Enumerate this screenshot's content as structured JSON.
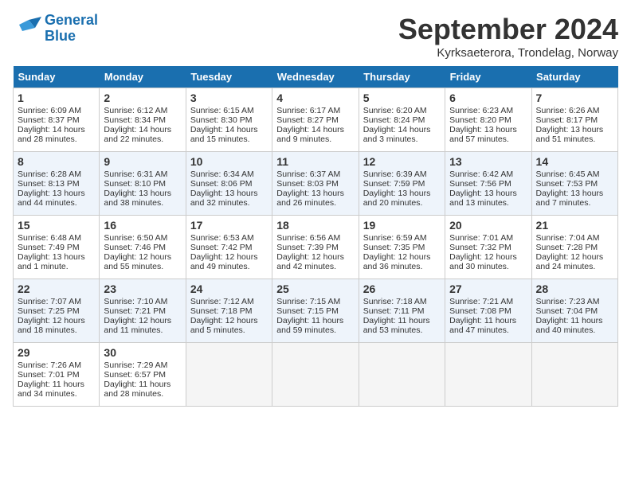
{
  "logo": {
    "line1": "General",
    "line2": "Blue"
  },
  "title": "September 2024",
  "subtitle": "Kyrksaeterora, Trondelag, Norway",
  "days_of_week": [
    "Sunday",
    "Monday",
    "Tuesday",
    "Wednesday",
    "Thursday",
    "Friday",
    "Saturday"
  ],
  "weeks": [
    [
      {
        "day": 1,
        "lines": [
          "Sunrise: 6:09 AM",
          "Sunset: 8:37 PM",
          "Daylight: 14 hours",
          "and 28 minutes."
        ]
      },
      {
        "day": 2,
        "lines": [
          "Sunrise: 6:12 AM",
          "Sunset: 8:34 PM",
          "Daylight: 14 hours",
          "and 22 minutes."
        ]
      },
      {
        "day": 3,
        "lines": [
          "Sunrise: 6:15 AM",
          "Sunset: 8:30 PM",
          "Daylight: 14 hours",
          "and 15 minutes."
        ]
      },
      {
        "day": 4,
        "lines": [
          "Sunrise: 6:17 AM",
          "Sunset: 8:27 PM",
          "Daylight: 14 hours",
          "and 9 minutes."
        ]
      },
      {
        "day": 5,
        "lines": [
          "Sunrise: 6:20 AM",
          "Sunset: 8:24 PM",
          "Daylight: 14 hours",
          "and 3 minutes."
        ]
      },
      {
        "day": 6,
        "lines": [
          "Sunrise: 6:23 AM",
          "Sunset: 8:20 PM",
          "Daylight: 13 hours",
          "and 57 minutes."
        ]
      },
      {
        "day": 7,
        "lines": [
          "Sunrise: 6:26 AM",
          "Sunset: 8:17 PM",
          "Daylight: 13 hours",
          "and 51 minutes."
        ]
      }
    ],
    [
      {
        "day": 8,
        "lines": [
          "Sunrise: 6:28 AM",
          "Sunset: 8:13 PM",
          "Daylight: 13 hours",
          "and 44 minutes."
        ]
      },
      {
        "day": 9,
        "lines": [
          "Sunrise: 6:31 AM",
          "Sunset: 8:10 PM",
          "Daylight: 13 hours",
          "and 38 minutes."
        ]
      },
      {
        "day": 10,
        "lines": [
          "Sunrise: 6:34 AM",
          "Sunset: 8:06 PM",
          "Daylight: 13 hours",
          "and 32 minutes."
        ]
      },
      {
        "day": 11,
        "lines": [
          "Sunrise: 6:37 AM",
          "Sunset: 8:03 PM",
          "Daylight: 13 hours",
          "and 26 minutes."
        ]
      },
      {
        "day": 12,
        "lines": [
          "Sunrise: 6:39 AM",
          "Sunset: 7:59 PM",
          "Daylight: 13 hours",
          "and 20 minutes."
        ]
      },
      {
        "day": 13,
        "lines": [
          "Sunrise: 6:42 AM",
          "Sunset: 7:56 PM",
          "Daylight: 13 hours",
          "and 13 minutes."
        ]
      },
      {
        "day": 14,
        "lines": [
          "Sunrise: 6:45 AM",
          "Sunset: 7:53 PM",
          "Daylight: 13 hours",
          "and 7 minutes."
        ]
      }
    ],
    [
      {
        "day": 15,
        "lines": [
          "Sunrise: 6:48 AM",
          "Sunset: 7:49 PM",
          "Daylight: 13 hours",
          "and 1 minute."
        ]
      },
      {
        "day": 16,
        "lines": [
          "Sunrise: 6:50 AM",
          "Sunset: 7:46 PM",
          "Daylight: 12 hours",
          "and 55 minutes."
        ]
      },
      {
        "day": 17,
        "lines": [
          "Sunrise: 6:53 AM",
          "Sunset: 7:42 PM",
          "Daylight: 12 hours",
          "and 49 minutes."
        ]
      },
      {
        "day": 18,
        "lines": [
          "Sunrise: 6:56 AM",
          "Sunset: 7:39 PM",
          "Daylight: 12 hours",
          "and 42 minutes."
        ]
      },
      {
        "day": 19,
        "lines": [
          "Sunrise: 6:59 AM",
          "Sunset: 7:35 PM",
          "Daylight: 12 hours",
          "and 36 minutes."
        ]
      },
      {
        "day": 20,
        "lines": [
          "Sunrise: 7:01 AM",
          "Sunset: 7:32 PM",
          "Daylight: 12 hours",
          "and 30 minutes."
        ]
      },
      {
        "day": 21,
        "lines": [
          "Sunrise: 7:04 AM",
          "Sunset: 7:28 PM",
          "Daylight: 12 hours",
          "and 24 minutes."
        ]
      }
    ],
    [
      {
        "day": 22,
        "lines": [
          "Sunrise: 7:07 AM",
          "Sunset: 7:25 PM",
          "Daylight: 12 hours",
          "and 18 minutes."
        ]
      },
      {
        "day": 23,
        "lines": [
          "Sunrise: 7:10 AM",
          "Sunset: 7:21 PM",
          "Daylight: 12 hours",
          "and 11 minutes."
        ]
      },
      {
        "day": 24,
        "lines": [
          "Sunrise: 7:12 AM",
          "Sunset: 7:18 PM",
          "Daylight: 12 hours",
          "and 5 minutes."
        ]
      },
      {
        "day": 25,
        "lines": [
          "Sunrise: 7:15 AM",
          "Sunset: 7:15 PM",
          "Daylight: 11 hours",
          "and 59 minutes."
        ]
      },
      {
        "day": 26,
        "lines": [
          "Sunrise: 7:18 AM",
          "Sunset: 7:11 PM",
          "Daylight: 11 hours",
          "and 53 minutes."
        ]
      },
      {
        "day": 27,
        "lines": [
          "Sunrise: 7:21 AM",
          "Sunset: 7:08 PM",
          "Daylight: 11 hours",
          "and 47 minutes."
        ]
      },
      {
        "day": 28,
        "lines": [
          "Sunrise: 7:23 AM",
          "Sunset: 7:04 PM",
          "Daylight: 11 hours",
          "and 40 minutes."
        ]
      }
    ],
    [
      {
        "day": 29,
        "lines": [
          "Sunrise: 7:26 AM",
          "Sunset: 7:01 PM",
          "Daylight: 11 hours",
          "and 34 minutes."
        ]
      },
      {
        "day": 30,
        "lines": [
          "Sunrise: 7:29 AM",
          "Sunset: 6:57 PM",
          "Daylight: 11 hours",
          "and 28 minutes."
        ]
      },
      null,
      null,
      null,
      null,
      null
    ]
  ]
}
